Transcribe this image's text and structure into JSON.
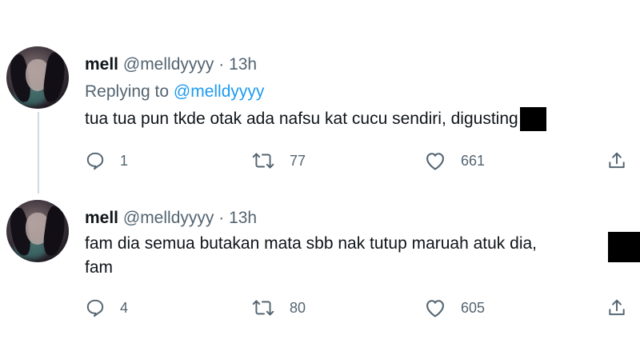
{
  "tweets": [
    {
      "name": "mell",
      "handle": "@melldyyyy",
      "separator": "·",
      "time": "13h",
      "replying_label": "Replying to",
      "replying_to": "@melldyyyy",
      "text": "tua tua pun tkde otak ada nafsu kat cucu sendiri, digusting",
      "replies": "1",
      "retweets": "77",
      "likes": "661"
    },
    {
      "name": "mell",
      "handle": "@melldyyyy",
      "separator": "·",
      "time": "13h",
      "text_line1": "fam dia semua butakan mata sbb nak tutup maruah atuk dia,",
      "text_line2": "fam",
      "replies": "4",
      "retweets": "80",
      "likes": "605"
    }
  ],
  "icons": {
    "reply": "reply-icon",
    "retweet": "retweet-icon",
    "like": "heart-icon",
    "share": "share-icon"
  },
  "colors": {
    "text": "#0f1419",
    "muted": "#536471",
    "link": "#1d9bf0",
    "thread_line": "#cfd9de"
  }
}
